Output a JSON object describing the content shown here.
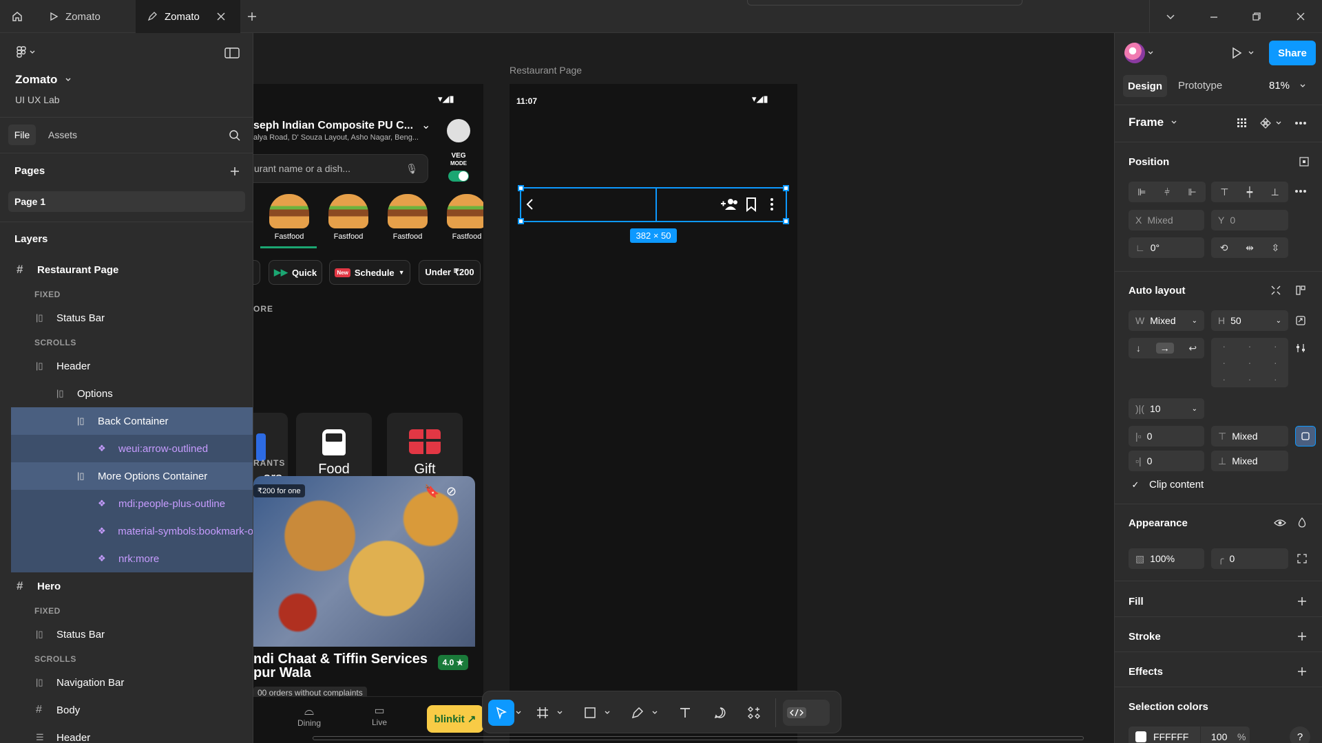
{
  "tabs": {
    "tab1": "Zomato",
    "tab2": "Zomato"
  },
  "left": {
    "project_name": "Zomato",
    "team": "UI UX Lab",
    "file_tab": "File",
    "assets_tab": "Assets",
    "pages_label": "Pages",
    "page1": "Page 1",
    "layers_label": "Layers",
    "layers": [
      "Restaurant Page",
      "FIXED",
      "Status Bar",
      "SCROLLS",
      "Header",
      "Options",
      "Back Container",
      "weui:arrow-outlined",
      "More Options Container",
      "mdi:people-plus-outline",
      "material-symbols:bookmark-o",
      "nrk:more",
      "Hero",
      "FIXED",
      "Status Bar",
      "SCROLLS",
      "Navigation Bar",
      "Body",
      "Header"
    ]
  },
  "canvas": {
    "frame_label": "Restaurant Page",
    "time": "11:07",
    "size_badge": "382 × 50",
    "hero": {
      "address_title": "seph Indian Composite PU C...",
      "address_sub": "alya Road, D' Souza Layout, Asho Nagar, Beng...",
      "search_placeholder": "urant name or a dish...",
      "veg_label": "VEG",
      "mode_label": "MODE",
      "food_labels": [
        "Fastfood",
        "Fastfood",
        "Fastfood",
        "Fastfood"
      ],
      "chip_quick": "Quick",
      "chip_new": "New",
      "chip_schedule": "Schedule",
      "chip_under": "Under ₹200",
      "section_more": "ORE",
      "card_partial": "ers",
      "card_train": "Food\non train",
      "card_gift": "Gift\nCards",
      "section_rest": "RANTS",
      "price_badge": "₹200 for one",
      "rest_name": "ndi Chaat & Tiffin Services",
      "rest_name2": "pur Wala",
      "rating": "4.0 ★",
      "orders": "00 orders without complaints",
      "nav_dining": "Dining",
      "nav_live": "Live",
      "blinkit": "blinkit ↗"
    }
  },
  "right": {
    "design_tab": "Design",
    "prototype_tab": "Prototype",
    "zoom": "81%",
    "share": "Share",
    "frame_label": "Frame",
    "position_title": "Position",
    "x_label": "X",
    "x_value": "Mixed",
    "y_label": "Y",
    "y_value": "0",
    "rotation": "0°",
    "auto_layout_title": "Auto layout",
    "w_label": "W",
    "w_value": "Mixed",
    "h_label": "H",
    "h_value": "50",
    "gap": "10",
    "pad_l": "0",
    "pad_t": "Mixed",
    "pad_r": "0",
    "pad_b": "Mixed",
    "clip_content": "Clip content",
    "appearance_title": "Appearance",
    "opacity": "100%",
    "radius": "0",
    "fill_title": "Fill",
    "stroke_title": "Stroke",
    "effects_title": "Effects",
    "selection_colors_title": "Selection colors",
    "color_hex": "FFFFFF",
    "color_opacity": "100",
    "percent": "%",
    "help": "?"
  },
  "colors": {
    "accent": "#0d99ff",
    "selection": "#4a5f80",
    "component": "#c79cff",
    "zomato_red": "#e23744"
  }
}
